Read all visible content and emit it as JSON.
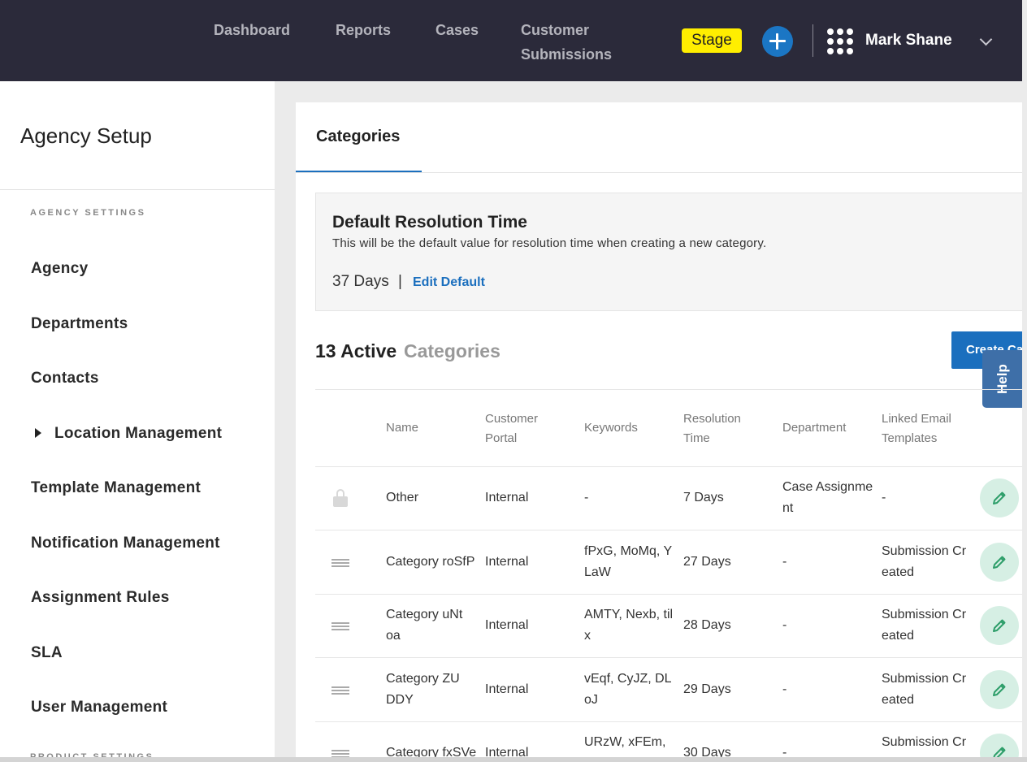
{
  "topbar": {
    "nav": [
      "Dashboard",
      "Reports",
      "Cases",
      "Customer Submissions"
    ],
    "env_badge": "Stage",
    "user_name": "Mark Shane"
  },
  "sidebar": {
    "title": "Agency Setup",
    "section_agency": "AGENCY SETTINGS",
    "items": [
      "Agency",
      "Departments",
      "Contacts",
      "Location Management",
      "Template Management",
      "Notification Management",
      "Assignment Rules",
      "SLA",
      "User Management"
    ],
    "section_product": "PRODUCT SETTINGS"
  },
  "page": {
    "tab": "Categories",
    "resolution": {
      "title": "Default Resolution Time",
      "description": "This will be the default value for resolution time when creating a new category.",
      "value": "37 Days",
      "separator": "|",
      "edit_label": "Edit Default"
    },
    "active_count": "13 Active",
    "active_suffix": "Categories",
    "create_label": "Create Category",
    "help_label": "Help"
  },
  "table": {
    "headers": [
      "Name",
      "Customer Portal",
      "Keywords",
      "Resolution Time",
      "Department",
      "Linked Email Templates"
    ],
    "rows": [
      {
        "name": "Other",
        "portal": "Internal",
        "keywords": "-",
        "resolution": "7 Days",
        "department": "Case Assignment",
        "templates": "-"
      },
      {
        "name": "Category roSfP",
        "portal": "Internal",
        "keywords": "fPxG, MoMq, YLaW",
        "resolution": "27 Days",
        "department": "-",
        "templates": "Submission Created"
      },
      {
        "name": "Category uNtoa",
        "portal": "Internal",
        "keywords": "AMTY, Nexb, tilx",
        "resolution": "28 Days",
        "department": "-",
        "templates": "Submission Created"
      },
      {
        "name": "Category ZUDDY",
        "portal": "Internal",
        "keywords": "vEqf, CyJZ, DLoJ",
        "resolution": "29 Days",
        "department": "-",
        "templates": "Submission Created"
      },
      {
        "name": "Category fxSVe",
        "portal": "Internal",
        "keywords": "URzW, xFEm, R",
        "resolution": "30 Days",
        "department": "-",
        "templates": "Submission Created"
      }
    ]
  }
}
